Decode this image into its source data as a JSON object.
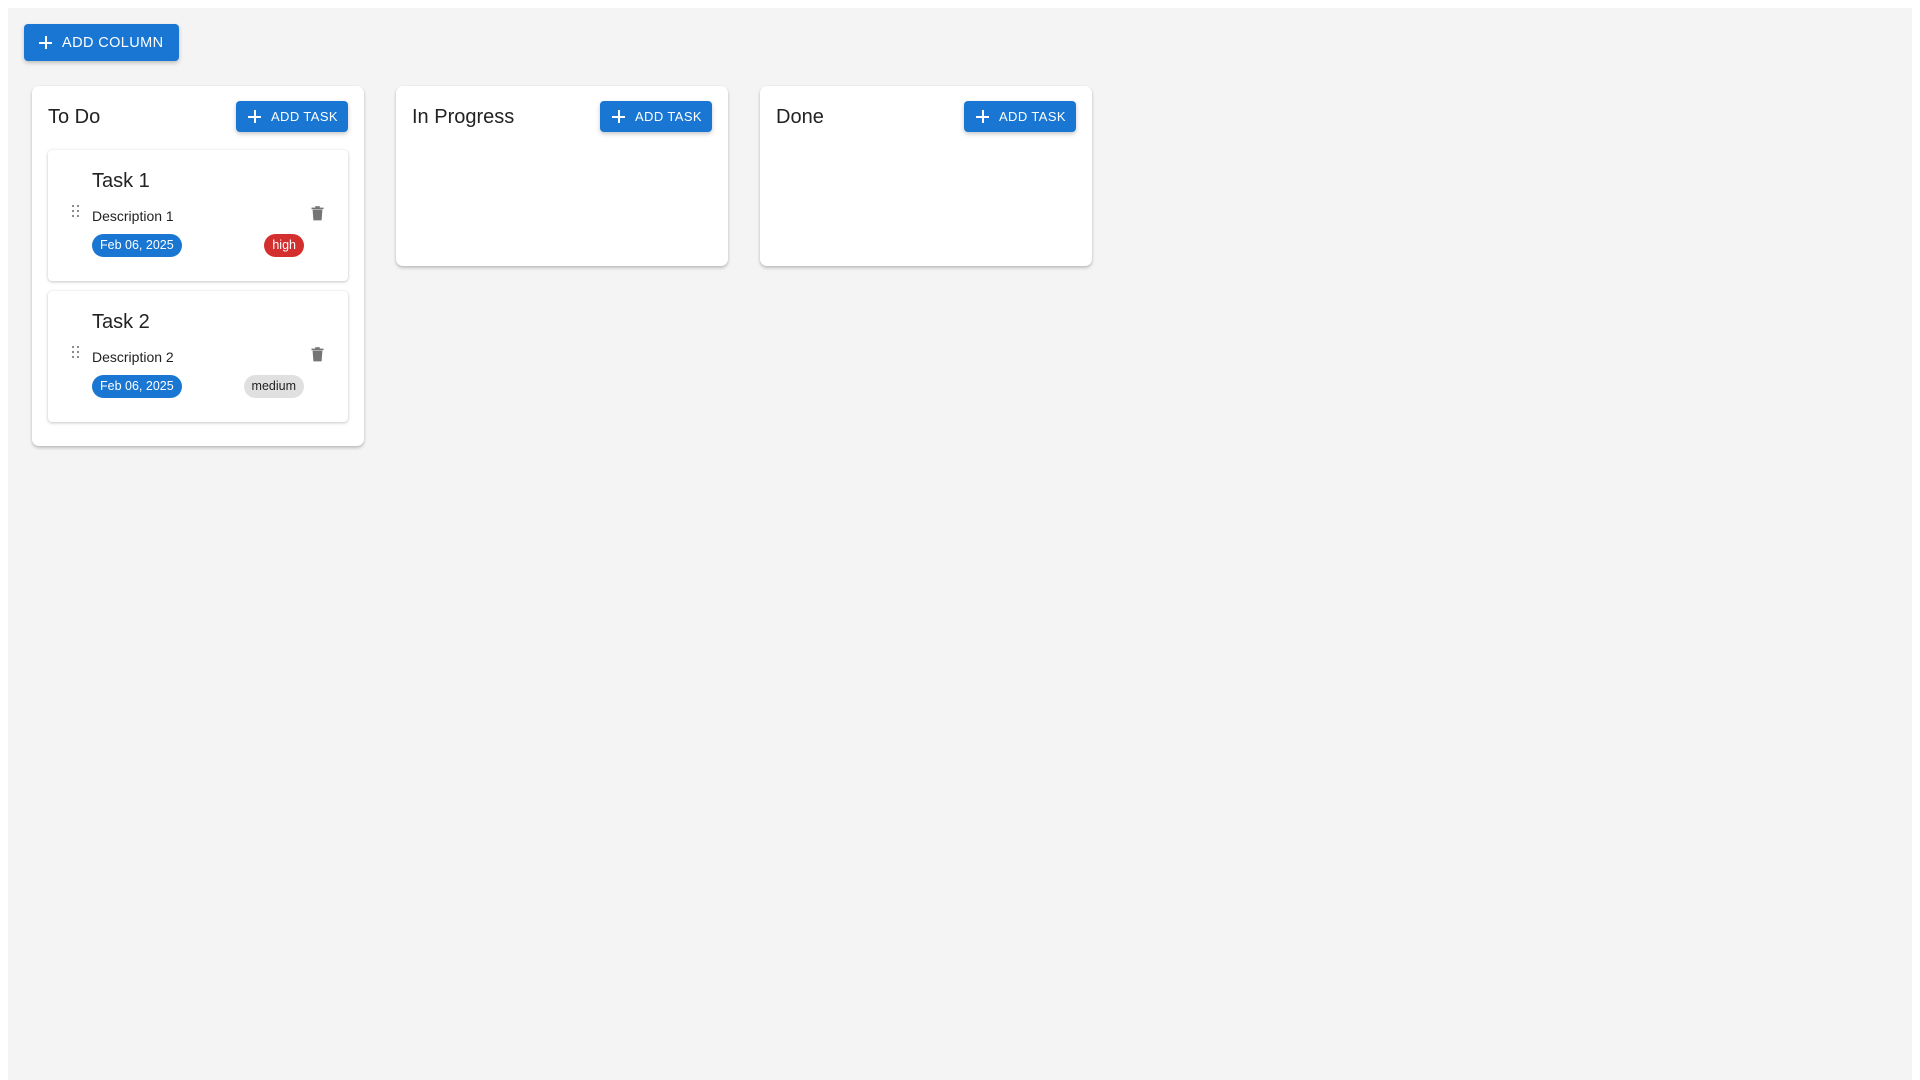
{
  "toolbar": {
    "add_column_label": "Add Column"
  },
  "colors": {
    "primary": "#1976d2",
    "priority_high": "#d32f2f",
    "priority_medium": "#e0e0e0",
    "background": "#f4f4f4"
  },
  "columns": [
    {
      "title": "To Do",
      "add_task_label": "Add Task",
      "tasks": [
        {
          "title": "Task 1",
          "description": "Description 1",
          "due_date": "Feb 06, 2025",
          "priority": "high"
        },
        {
          "title": "Task 2",
          "description": "Description 2",
          "due_date": "Feb 06, 2025",
          "priority": "medium"
        }
      ]
    },
    {
      "title": "In Progress",
      "add_task_label": "Add Task",
      "tasks": []
    },
    {
      "title": "Done",
      "add_task_label": "Add Task",
      "tasks": []
    }
  ],
  "icons": {
    "add": "plus-icon",
    "drag": "drag-handle-icon",
    "delete": "trash-icon"
  }
}
